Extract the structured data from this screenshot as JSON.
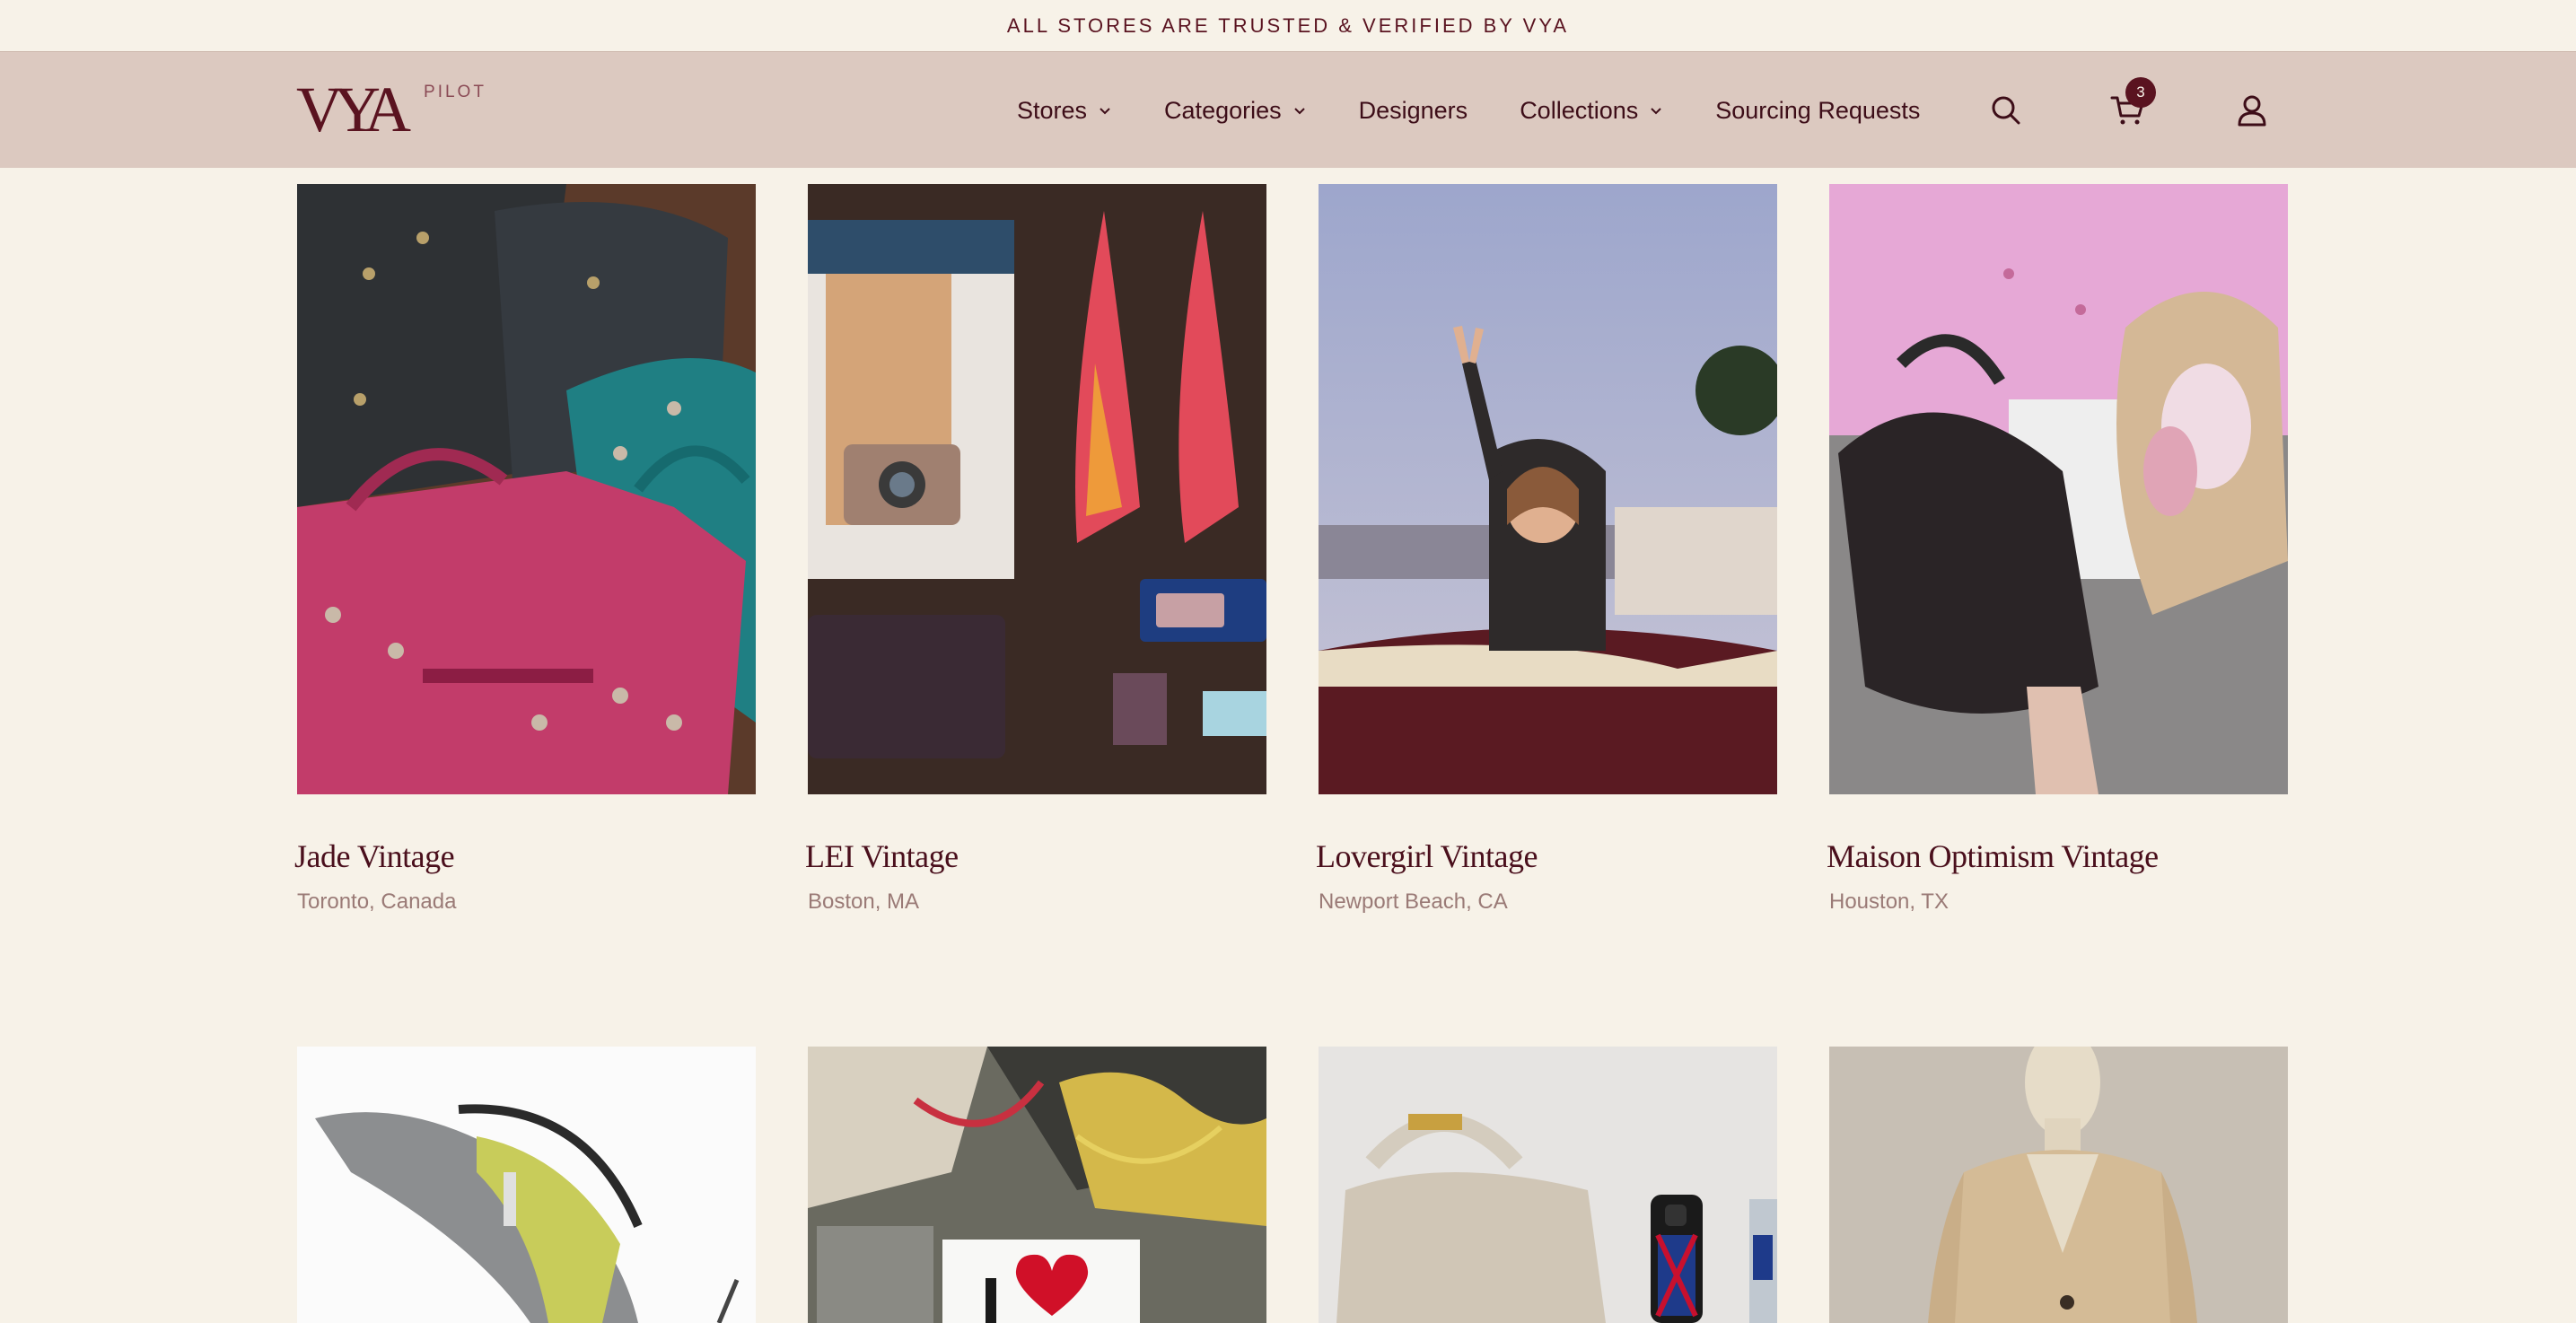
{
  "announcement": "ALL STORES ARE TRUSTED & VERIFIED BY VYA",
  "brand": {
    "logo": "VYA",
    "sub": "PILOT"
  },
  "nav": {
    "items": [
      {
        "label": "Stores",
        "dropdown": true
      },
      {
        "label": "Categories",
        "dropdown": true
      },
      {
        "label": "Designers",
        "dropdown": false
      },
      {
        "label": "Collections",
        "dropdown": true
      },
      {
        "label": "Sourcing Requests",
        "dropdown": false
      }
    ],
    "cart_count": "3",
    "icons": [
      "search-icon",
      "cart-icon",
      "account-icon"
    ]
  },
  "stores": [
    {
      "name": "Jade Vintage",
      "location": "Toronto, Canada"
    },
    {
      "name": "LEI Vintage",
      "location": "Boston, MA"
    },
    {
      "name": "Lovergirl Vintage",
      "location": "Newport Beach, CA"
    },
    {
      "name": "Maison Optimism Vintage",
      "location": "Houston, TX"
    }
  ],
  "colors": {
    "background": "#f7f2e8",
    "navbar": "#dcc9c0",
    "accent": "#5a1320"
  }
}
